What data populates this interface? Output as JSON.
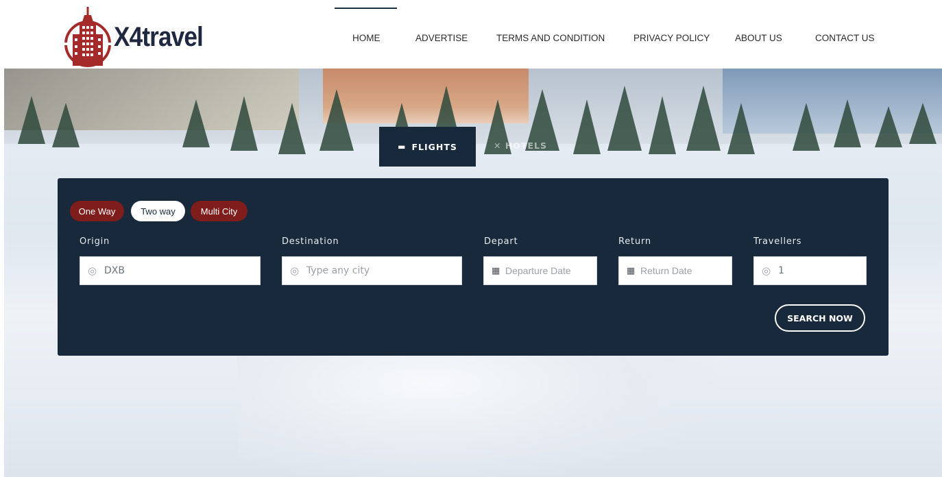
{
  "logo": {
    "text": "X4travel",
    "brand_color": "#a52a2a"
  },
  "nav": {
    "items": [
      "HOME",
      "ADVERTISE",
      "TERMS AND CONDITION",
      "PRIVACY POLICY",
      "ABOUT US",
      "CONTACT US"
    ],
    "active": "HOME"
  },
  "tabs": {
    "flights": {
      "label": "FLIGHTS",
      "icon": "bed-icon"
    },
    "hotels": {
      "label": "HOTELS",
      "icon": "plane-icon"
    }
  },
  "trip_types": {
    "one_way": "One Way",
    "two_way": "Two way",
    "multi_city": "Multi City",
    "selected": "Two way"
  },
  "form": {
    "origin": {
      "label": "Origin",
      "value": "DXB",
      "icon": "location-pin-icon"
    },
    "destination": {
      "label": "Destination",
      "placeholder": "Type any city",
      "icon": "location-pin-icon"
    },
    "depart": {
      "label": "Depart",
      "placeholder": "Departure Date",
      "icon": "calendar-icon"
    },
    "return": {
      "label": "Return",
      "placeholder": "Return Date",
      "icon": "calendar-icon"
    },
    "travellers": {
      "label": "Travellers",
      "value": "1",
      "icon": "location-pin-icon"
    }
  },
  "search_button": "SEARCH NOW",
  "colors": {
    "panel": "#17293b",
    "pill_red": "#7f1d1d",
    "accent": "#a52a2a"
  }
}
